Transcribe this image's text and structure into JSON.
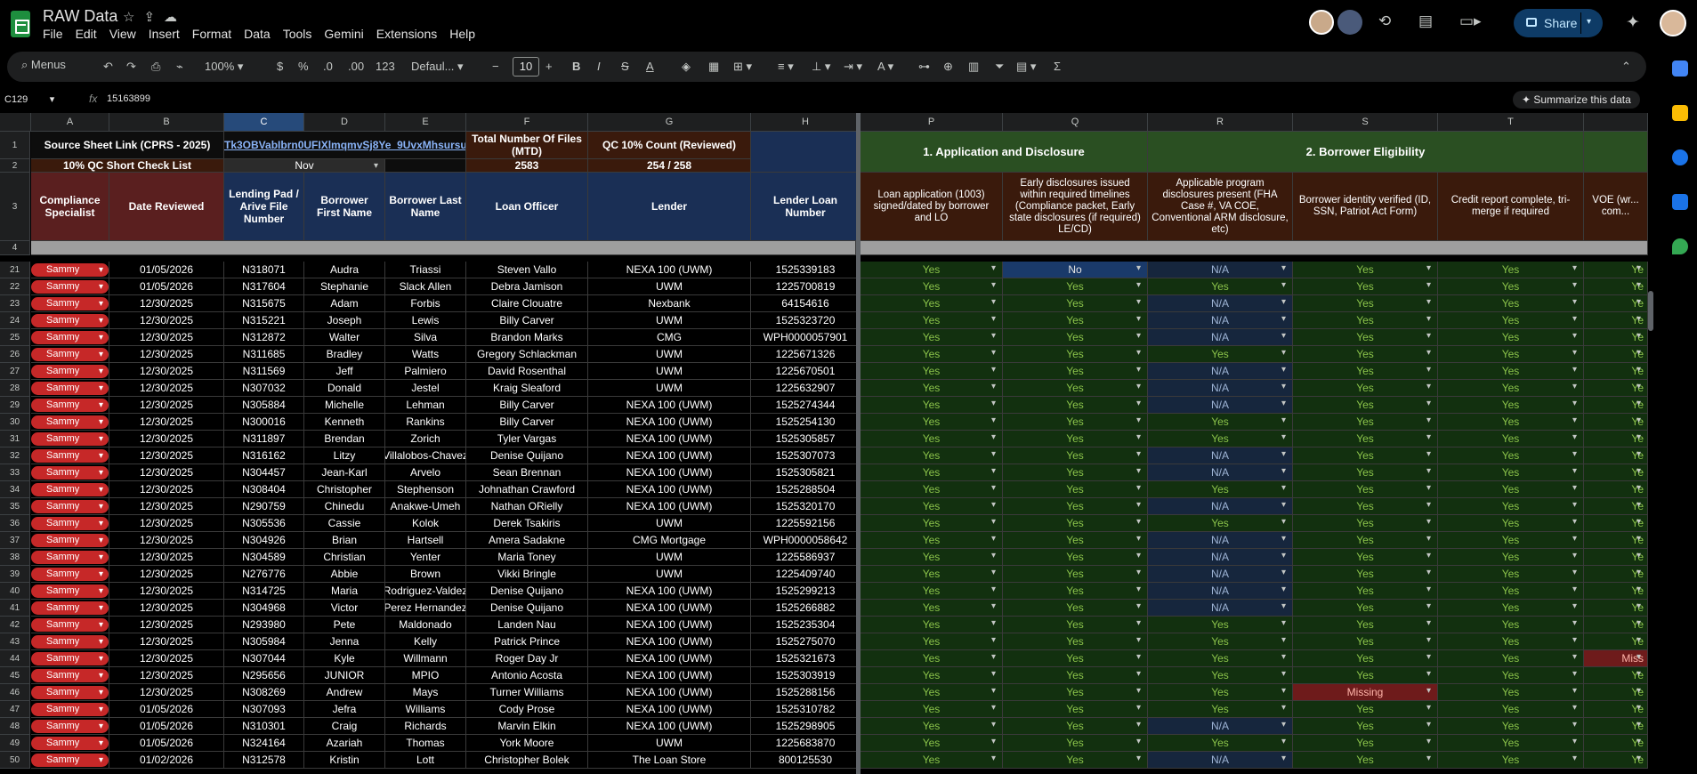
{
  "app": {
    "title": "RAW Data",
    "menu": [
      "File",
      "Edit",
      "View",
      "Insert",
      "Format",
      "Data",
      "Tools",
      "Gemini",
      "Extensions",
      "Help"
    ],
    "share_label": "Share"
  },
  "toolbar": {
    "search_label": "Menus",
    "zoom": "100%",
    "currency": "$",
    "percent": "%",
    "dec_decrease": ".0",
    "dec_increase": ".00",
    "number_format": "123",
    "font": "Defaul...",
    "font_size": "10",
    "bold": "B",
    "italic": "I",
    "strike": "S",
    "text_color": "A"
  },
  "formula": {
    "cell_ref": "C129",
    "fx": "fx",
    "value": "15163899",
    "summarize_label": "Summarize this data"
  },
  "columns": [
    "A",
    "B",
    "C",
    "D",
    "E",
    "F",
    "G",
    "H",
    "P",
    "Q",
    "R",
    "S",
    "T"
  ],
  "header_rows": {
    "row1": {
      "a_b": "Source Sheet Link (CPRS - 2025)",
      "c_e_link": "Tk3OBVabIbrn0UFIXlmqmvSj8Ye_9UvxMhsursu",
      "f": "Total Number Of Files (MTD)",
      "g": "QC 10% Count (Reviewed)",
      "section1": "1. Application and Disclosure",
      "section2": "2. Borrower Eligibility"
    },
    "row2": {
      "a_b": "10% QC Short Check List",
      "month": "Nov",
      "f": "2583",
      "g": "254 / 258"
    },
    "row3": [
      "Compliance Specialist",
      "Date Reviewed",
      "Lending Pad / Arive File Number",
      "Borrower First Name",
      "Borrower Last Name",
      "Loan Officer",
      "Lender",
      "Lender Loan Number",
      "Loan application (1003) signed/dated by borrower and LO",
      "Early disclosures issued within required timelines (Compliance packet, Early state disclosures (if required) LE/CD)",
      "Applicable program disclosures present (FHA Case #, VA COE, Conventional ARM disclosure, etc)",
      "Borrower identity verified (ID, SSN, Patriot Act Form)",
      "Credit report complete, tri-merge if required",
      "VOE (wr... com..."
    ]
  },
  "rows": [
    {
      "n": "21",
      "spec": "Sammy",
      "date": "01/05/2026",
      "file": "N318071",
      "first": "Audra",
      "last": "Triassi",
      "lo": "Steven Vallo",
      "lender": "NEXA 100 (UWM)",
      "loan": "1525339183",
      "p": "Yes",
      "q": "No",
      "r": "N/A",
      "s": "Yes",
      "t": "Yes",
      "u": "Ye"
    },
    {
      "n": "22",
      "spec": "Sammy",
      "date": "01/05/2026",
      "file": "N317604",
      "first": "Stephanie",
      "last": "Slack Allen",
      "lo": "Debra Jamison",
      "lender": "UWM",
      "loan": "1225700819",
      "p": "Yes",
      "q": "Yes",
      "r": "Yes",
      "s": "Yes",
      "t": "Yes",
      "u": "Ye"
    },
    {
      "n": "23",
      "spec": "Sammy",
      "date": "12/30/2025",
      "file": "N315675",
      "first": "Adam",
      "last": "Forbis",
      "lo": "Claire Clouatre",
      "lender": "Nexbank",
      "loan": "64154616",
      "p": "Yes",
      "q": "Yes",
      "r": "N/A",
      "s": "Yes",
      "t": "Yes",
      "u": "Ye"
    },
    {
      "n": "24",
      "spec": "Sammy",
      "date": "12/30/2025",
      "file": "N315221",
      "first": "Joseph",
      "last": "Lewis",
      "lo": "Billy Carver",
      "lender": "UWM",
      "loan": "1525323720",
      "p": "Yes",
      "q": "Yes",
      "r": "N/A",
      "s": "Yes",
      "t": "Yes",
      "u": "Ye"
    },
    {
      "n": "25",
      "spec": "Sammy",
      "date": "12/30/2025",
      "file": "N312872",
      "first": "Walter",
      "last": "Silva",
      "lo": "Brandon Marks",
      "lender": "CMG",
      "loan": "WPH0000057901",
      "p": "Yes",
      "q": "Yes",
      "r": "N/A",
      "s": "Yes",
      "t": "Yes",
      "u": "Ye"
    },
    {
      "n": "26",
      "spec": "Sammy",
      "date": "12/30/2025",
      "file": "N311685",
      "first": "Bradley",
      "last": "Watts",
      "lo": "Gregory Schlackman",
      "lender": "UWM",
      "loan": "1225671326",
      "p": "Yes",
      "q": "Yes",
      "r": "Yes",
      "s": "Yes",
      "t": "Yes",
      "u": "Ye"
    },
    {
      "n": "27",
      "spec": "Sammy",
      "date": "12/30/2025",
      "file": "N311569",
      "first": "Jeff",
      "last": "Palmiero",
      "lo": "David Rosenthal",
      "lender": "UWM",
      "loan": "1225670501",
      "p": "Yes",
      "q": "Yes",
      "r": "N/A",
      "s": "Yes",
      "t": "Yes",
      "u": "Ye"
    },
    {
      "n": "28",
      "spec": "Sammy",
      "date": "12/30/2025",
      "file": "N307032",
      "first": "Donald",
      "last": "Jestel",
      "lo": "Kraig Sleaford",
      "lender": "UWM",
      "loan": "1225632907",
      "p": "Yes",
      "q": "Yes",
      "r": "N/A",
      "s": "Yes",
      "t": "Yes",
      "u": "Ye"
    },
    {
      "n": "29",
      "spec": "Sammy",
      "date": "12/30/2025",
      "file": "N305884",
      "first": "Michelle",
      "last": "Lehman",
      "lo": "Billy Carver",
      "lender": "NEXA 100 (UWM)",
      "loan": "1525274344",
      "p": "Yes",
      "q": "Yes",
      "r": "N/A",
      "s": "Yes",
      "t": "Yes",
      "u": "Ye"
    },
    {
      "n": "30",
      "spec": "Sammy",
      "date": "12/30/2025",
      "file": "N300016",
      "first": "Kenneth",
      "last": "Rankins",
      "lo": "Billy Carver",
      "lender": "NEXA 100 (UWM)",
      "loan": "1525254130",
      "p": "Yes",
      "q": "Yes",
      "r": "Yes",
      "s": "Yes",
      "t": "Yes",
      "u": "Ye"
    },
    {
      "n": "31",
      "spec": "Sammy",
      "date": "12/30/2025",
      "file": "N311897",
      "first": "Brendan",
      "last": "Zorich",
      "lo": "Tyler Vargas",
      "lender": "NEXA 100 (UWM)",
      "loan": "1525305857",
      "p": "Yes",
      "q": "Yes",
      "r": "Yes",
      "s": "Yes",
      "t": "Yes",
      "u": "Ye"
    },
    {
      "n": "32",
      "spec": "Sammy",
      "date": "12/30/2025",
      "file": "N316162",
      "first": "Litzy",
      "last": "Villalobos-Chavez",
      "lo": "Denise Quijano",
      "lender": "NEXA 100 (UWM)",
      "loan": "1525307073",
      "p": "Yes",
      "q": "Yes",
      "r": "N/A",
      "s": "Yes",
      "t": "Yes",
      "u": "Ye"
    },
    {
      "n": "33",
      "spec": "Sammy",
      "date": "12/30/2025",
      "file": "N304457",
      "first": "Jean-Karl",
      "last": "Arvelo",
      "lo": "Sean Brennan",
      "lender": "NEXA 100 (UWM)",
      "loan": "1525305821",
      "p": "Yes",
      "q": "Yes",
      "r": "N/A",
      "s": "Yes",
      "t": "Yes",
      "u": "Ye"
    },
    {
      "n": "34",
      "spec": "Sammy",
      "date": "12/30/2025",
      "file": "N308404",
      "first": "Christopher",
      "last": "Stephenson",
      "lo": "Johnathan Crawford",
      "lender": "NEXA 100 (UWM)",
      "loan": "1525288504",
      "p": "Yes",
      "q": "Yes",
      "r": "Yes",
      "s": "Yes",
      "t": "Yes",
      "u": "Ye"
    },
    {
      "n": "35",
      "spec": "Sammy",
      "date": "12/30/2025",
      "file": "N290759",
      "first": "Chinedu",
      "last": "Anakwe-Umeh",
      "lo": "Nathan ORielly",
      "lender": "NEXA 100 (UWM)",
      "loan": "1525320170",
      "p": "Yes",
      "q": "Yes",
      "r": "N/A",
      "s": "Yes",
      "t": "Yes",
      "u": "Ye"
    },
    {
      "n": "36",
      "spec": "Sammy",
      "date": "12/30/2025",
      "file": "N305536",
      "first": "Cassie",
      "last": "Kolok",
      "lo": "Derek Tsakiris",
      "lender": "UWM",
      "loan": "1225592156",
      "p": "Yes",
      "q": "Yes",
      "r": "Yes",
      "s": "Yes",
      "t": "Yes",
      "u": "Ye"
    },
    {
      "n": "37",
      "spec": "Sammy",
      "date": "12/30/2025",
      "file": "N304926",
      "first": "Brian",
      "last": "Hartsell",
      "lo": "Amera Sadakne",
      "lender": "CMG Mortgage",
      "loan": "WPH0000058642",
      "p": "Yes",
      "q": "Yes",
      "r": "N/A",
      "s": "Yes",
      "t": "Yes",
      "u": "Ye"
    },
    {
      "n": "38",
      "spec": "Sammy",
      "date": "12/30/2025",
      "file": "N304589",
      "first": "Christian",
      "last": "Yenter",
      "lo": "Maria Toney",
      "lender": "UWM",
      "loan": "1225586937",
      "p": "Yes",
      "q": "Yes",
      "r": "N/A",
      "s": "Yes",
      "t": "Yes",
      "u": "Ye"
    },
    {
      "n": "39",
      "spec": "Sammy",
      "date": "12/30/2025",
      "file": "N276776",
      "first": "Abbie",
      "last": "Brown",
      "lo": "Vikki Bringle",
      "lender": "UWM",
      "loan": "1225409740",
      "p": "Yes",
      "q": "Yes",
      "r": "N/A",
      "s": "Yes",
      "t": "Yes",
      "u": "Ye"
    },
    {
      "n": "40",
      "spec": "Sammy",
      "date": "12/30/2025",
      "file": "N314725",
      "first": "Maria",
      "last": "Rodriguez-Valdez",
      "lo": "Denise Quijano",
      "lender": "NEXA 100 (UWM)",
      "loan": "1525299213",
      "p": "Yes",
      "q": "Yes",
      "r": "N/A",
      "s": "Yes",
      "t": "Yes",
      "u": "Ye"
    },
    {
      "n": "41",
      "spec": "Sammy",
      "date": "12/30/2025",
      "file": "N304968",
      "first": "Victor",
      "last": "Perez Hernandez",
      "lo": "Denise Quijano",
      "lender": "NEXA 100 (UWM)",
      "loan": "1525266882",
      "p": "Yes",
      "q": "Yes",
      "r": "N/A",
      "s": "Yes",
      "t": "Yes",
      "u": "Ye"
    },
    {
      "n": "42",
      "spec": "Sammy",
      "date": "12/30/2025",
      "file": "N293980",
      "first": "Pete",
      "last": "Maldonado",
      "lo": "Landen Nau",
      "lender": "NEXA 100 (UWM)",
      "loan": "1525235304",
      "p": "Yes",
      "q": "Yes",
      "r": "Yes",
      "s": "Yes",
      "t": "Yes",
      "u": "Ye"
    },
    {
      "n": "43",
      "spec": "Sammy",
      "date": "12/30/2025",
      "file": "N305984",
      "first": "Jenna",
      "last": "Kelly",
      "lo": "Patrick Prince",
      "lender": "NEXA 100 (UWM)",
      "loan": "1525275070",
      "p": "Yes",
      "q": "Yes",
      "r": "Yes",
      "s": "Yes",
      "t": "Yes",
      "u": "Ye"
    },
    {
      "n": "44",
      "spec": "Sammy",
      "date": "12/30/2025",
      "file": "N307044",
      "first": "Kyle",
      "last": "Willmann",
      "lo": "Roger Day Jr",
      "lender": "NEXA 100 (UWM)",
      "loan": "1525321673",
      "p": "Yes",
      "q": "Yes",
      "r": "Yes",
      "s": "Yes",
      "t": "Yes",
      "u": "Miss"
    },
    {
      "n": "45",
      "spec": "Sammy",
      "date": "12/30/2025",
      "file": "N295656",
      "first": "JUNIOR",
      "last": "MPIO",
      "lo": "Antonio Acosta",
      "lender": "NEXA 100 (UWM)",
      "loan": "1525303919",
      "p": "Yes",
      "q": "Yes",
      "r": "Yes",
      "s": "Yes",
      "t": "Yes",
      "u": "Ye"
    },
    {
      "n": "46",
      "spec": "Sammy",
      "date": "12/30/2025",
      "file": "N308269",
      "first": "Andrew",
      "last": "Mays",
      "lo": "Turner Williams",
      "lender": "NEXA 100 (UWM)",
      "loan": "1525288156",
      "p": "Yes",
      "q": "Yes",
      "r": "Yes",
      "s": "Missing",
      "t": "Yes",
      "u": "Ye"
    },
    {
      "n": "47",
      "spec": "Sammy",
      "date": "01/05/2026",
      "file": "N307093",
      "first": "Jefra",
      "last": "Williams",
      "lo": "Cody Prose",
      "lender": "NEXA 100 (UWM)",
      "loan": "1525310782",
      "p": "Yes",
      "q": "Yes",
      "r": "Yes",
      "s": "Yes",
      "t": "Yes",
      "u": "Ye"
    },
    {
      "n": "48",
      "spec": "Sammy",
      "date": "01/05/2026",
      "file": "N310301",
      "first": "Craig",
      "last": "Richards",
      "lo": "Marvin Elkin",
      "lender": "NEXA 100 (UWM)",
      "loan": "1525298905",
      "p": "Yes",
      "q": "Yes",
      "r": "N/A",
      "s": "Yes",
      "t": "Yes",
      "u": "Ye"
    },
    {
      "n": "49",
      "spec": "Sammy",
      "date": "01/05/2026",
      "file": "N324164",
      "first": "Azariah",
      "last": "Thomas",
      "lo": "York Moore",
      "lender": "UWM",
      "loan": "1225683870",
      "p": "Yes",
      "q": "Yes",
      "r": "Yes",
      "s": "Yes",
      "t": "Yes",
      "u": "Ye"
    },
    {
      "n": "50",
      "spec": "Sammy",
      "date": "01/02/2026",
      "file": "N312578",
      "first": "Kristin",
      "last": "Lott",
      "lo": "Christopher Bolek",
      "lender": "The Loan Store",
      "loan": "800125530",
      "p": "Yes",
      "q": "Yes",
      "r": "N/A",
      "s": "Yes",
      "t": "Yes",
      "u": "Ye"
    }
  ]
}
